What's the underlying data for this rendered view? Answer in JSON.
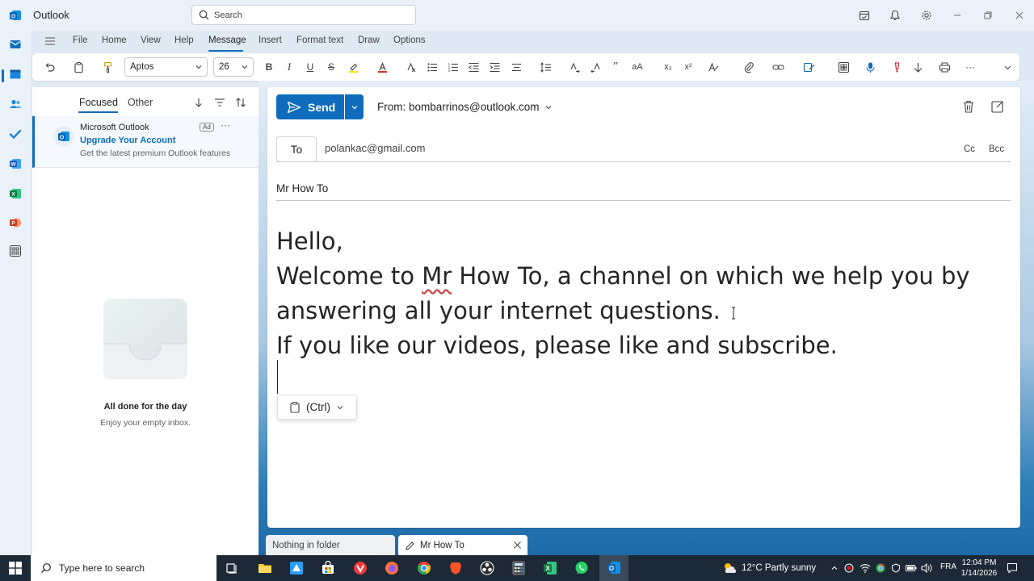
{
  "app": {
    "title": "Outlook"
  },
  "search": {
    "placeholder": "Search"
  },
  "menu": {
    "items": [
      "File",
      "Home",
      "View",
      "Help",
      "Message",
      "Insert",
      "Format text",
      "Draw",
      "Options"
    ],
    "active": "Message"
  },
  "ribbon": {
    "font": "Aptos",
    "size": "26"
  },
  "list": {
    "tab_focused": "Focused",
    "tab_other": "Other",
    "ad": {
      "sender": "Microsoft Outlook",
      "badge": "Ad",
      "subject": "Upgrade Your Account",
      "preview": "Get the latest premium Outlook features"
    },
    "empty_title": "All done for the day",
    "empty_sub": "Enjoy your empty inbox."
  },
  "compose": {
    "send_label": "Send",
    "from": "From: bombarrinos@outlook.com",
    "to_label": "To",
    "to_value": "polankac@gmail.com",
    "cc": "Cc",
    "bcc": "Bcc",
    "subject": "Mr How To",
    "body": {
      "line1": "Hello,",
      "line2_a": "Welcome to ",
      "line2_b": "Mr",
      "line2_c": " How To, a channel on which we help you by answering all your internet questions. ",
      "line3": "If you like our videos, please like and subscribe."
    },
    "paste_label": "(Ctrl)"
  },
  "bottom_tabs": {
    "tab1": "Nothing in folder",
    "tab2": "Mr How To"
  },
  "taskbar": {
    "search_placeholder": "Type here to search",
    "weather": "12°C  Partly sunny",
    "lang": "FRA",
    "time": "12:04 PM",
    "date": "1/14/2026"
  },
  "colors": {
    "accent": "#0f6cbd",
    "taskbar": "#1d2936"
  }
}
